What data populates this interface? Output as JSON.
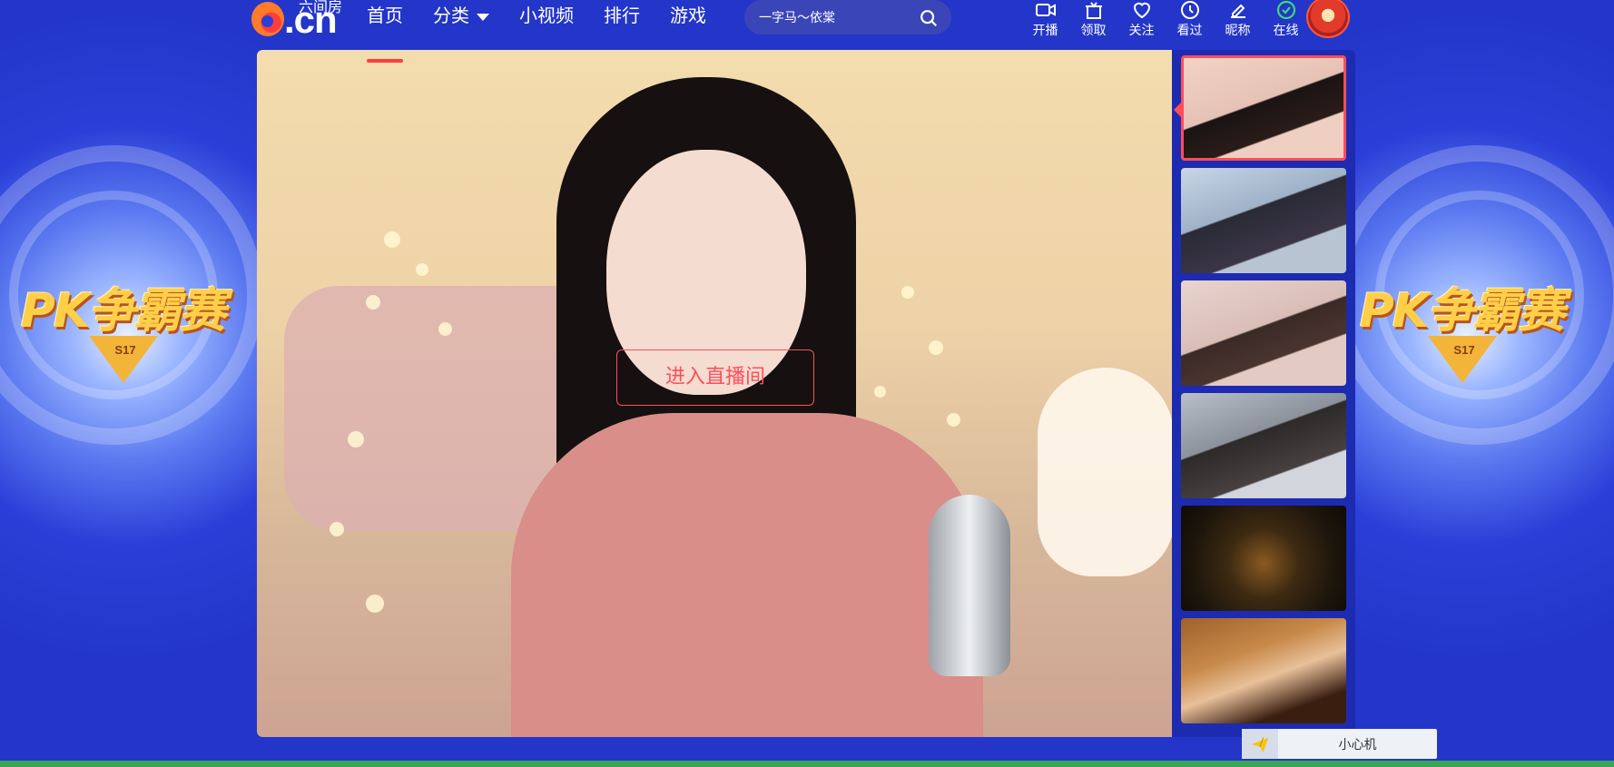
{
  "logo": {
    "small_text": "六间房",
    "main_text": ".cn"
  },
  "nav": {
    "items": [
      {
        "label": "首页",
        "active": true
      },
      {
        "label": "分类",
        "has_dropdown": true
      },
      {
        "label": "小视频"
      },
      {
        "label": "排行"
      },
      {
        "label": "游戏"
      }
    ]
  },
  "search": {
    "placeholder": "一字马～依棠"
  },
  "toolbar": {
    "items": [
      {
        "label": "开播",
        "icon": "video-camera-icon"
      },
      {
        "label": "领取",
        "icon": "gift-icon"
      },
      {
        "label": "关注",
        "icon": "heart-icon"
      },
      {
        "label": "看过",
        "icon": "clock-icon"
      },
      {
        "label": "昵称",
        "icon": "edit-icon"
      },
      {
        "label": "在线",
        "icon": "check-circle-icon"
      }
    ]
  },
  "banner": {
    "left_title": "PK争霸赛",
    "left_sub": "S17",
    "right_title": "PK争霸赛",
    "right_sub": "S17"
  },
  "player": {
    "enter_label": "进入直播间"
  },
  "rail": {
    "thumbnails": [
      {
        "active": true,
        "colors": [
          "#f2d3c6",
          "#1a1414"
        ]
      },
      {
        "active": false,
        "colors": [
          "#c8d6e6",
          "#2a2a36"
        ]
      },
      {
        "active": false,
        "colors": [
          "#e9d4cf",
          "#3a2a26"
        ]
      },
      {
        "active": false,
        "colors": [
          "#b9bfc8",
          "#2d2a2a"
        ]
      },
      {
        "active": false,
        "colors": [
          "#2a1f10",
          "#8a5a20"
        ]
      },
      {
        "active": false,
        "colors": [
          "#a0602a",
          "#3a1e10"
        ]
      }
    ]
  },
  "float_bar": {
    "label": "小心机"
  },
  "colors": {
    "accent": "#ff4d5a",
    "bg": "#2a3fd6",
    "rail_bg": "#1d2bb0"
  }
}
